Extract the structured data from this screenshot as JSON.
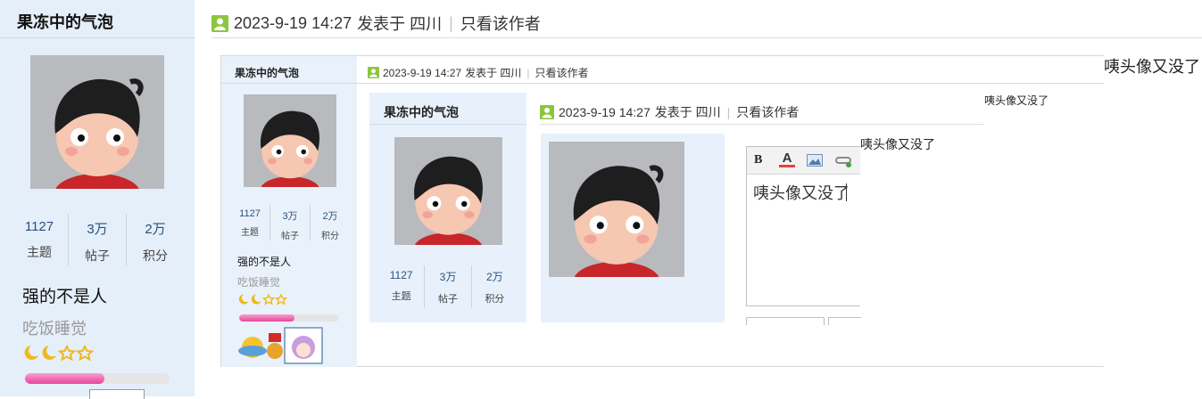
{
  "user": {
    "name": "果冻中的气泡",
    "stats": [
      {
        "value": "1127",
        "label": "主题"
      },
      {
        "value": "3万",
        "label": "帖子"
      },
      {
        "value": "2万",
        "label": "积分"
      }
    ],
    "rank_title": "强的不是人",
    "rank_sub": "吃饭睡觉",
    "level_progress": 0.55
  },
  "post": {
    "date": "2023-9-19 14:27",
    "posted_in": "发表于 四川",
    "only_author": "只看该作者",
    "content": "咦头像又没了"
  },
  "editor": {
    "bold": "B",
    "font_color": "A",
    "text": "咦头像又没了"
  },
  "colors": {
    "sidebar_bg": "#e5effa",
    "accent_pink": "#e8449c",
    "user_icon": "#8cc63f"
  }
}
